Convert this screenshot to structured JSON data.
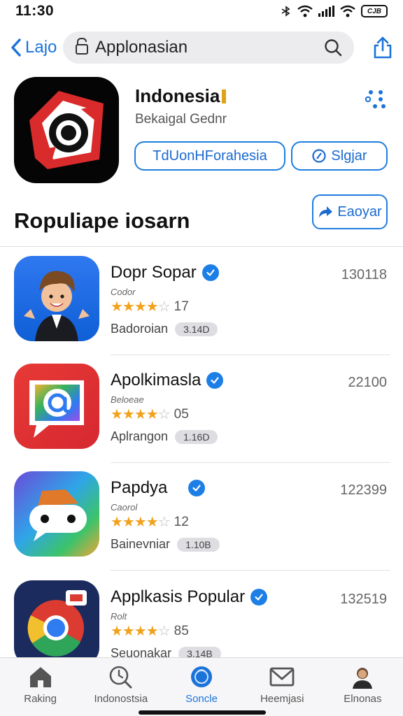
{
  "status_bar": {
    "time": "11:30",
    "battery": "CJB"
  },
  "nav": {
    "back_label": "Lajo",
    "search_text": "Applonasian"
  },
  "app": {
    "title": "Indonesia",
    "subtitle": "Bekaigal Gednr",
    "primary_button": "TdUonHForahesia",
    "secondary_button": "Slgjar",
    "icon": "camera-app-icon"
  },
  "section": {
    "title": "Ropuliape iosarn",
    "button_label": "Eaoyar"
  },
  "apps": [
    {
      "name": "Dopr Sopar",
      "sub": "Codor",
      "rating": 4.5,
      "rating_count": "17",
      "category": "Badoroian",
      "size": "3.14D",
      "count": "130118",
      "icon": "avatar-app-icon"
    },
    {
      "name": "Apolkimasla",
      "sub": "Beloeae",
      "rating": 4.5,
      "rating_count": "05",
      "category": "Aplrangon",
      "size": "1.16D",
      "count": "22100",
      "icon": "at-chat-app-icon"
    },
    {
      "name": "Papdya",
      "sub": "Caorol",
      "rating": 4.5,
      "rating_count": "12",
      "category": "Bainevniar",
      "size": "1.10B",
      "count": "122399",
      "icon": "robot-chat-app-icon"
    },
    {
      "name": "Applkasis Popular",
      "sub": "Rolt",
      "rating": 4.5,
      "rating_count": "85",
      "category": "Seuonakar",
      "size": "3.14B",
      "count": "132519",
      "icon": "browser-app-icon"
    }
  ],
  "tabs": [
    {
      "label": "Raking",
      "icon": "home-icon",
      "active": false
    },
    {
      "label": "Indonostsia",
      "icon": "search-clock-icon",
      "active": false
    },
    {
      "label": "Soncle",
      "icon": "globe-icon",
      "active": true
    },
    {
      "label": "Heemjasi",
      "icon": "mail-icon",
      "active": false
    },
    {
      "label": "Elnonas",
      "icon": "profile-icon",
      "active": false
    }
  ]
}
